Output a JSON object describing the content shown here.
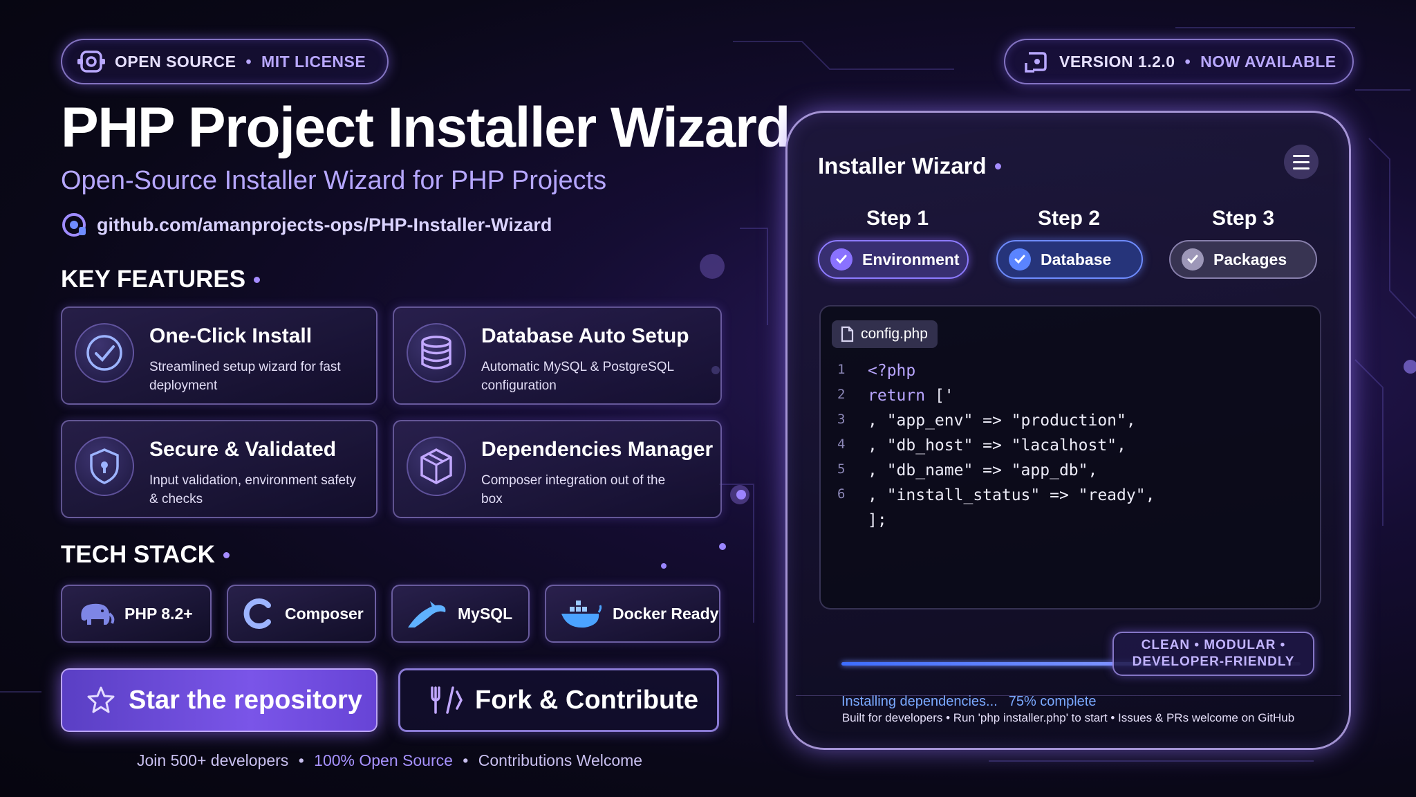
{
  "top_badges": {
    "left": {
      "text": "OPEN SOURCE",
      "sep": "•",
      "highlight": "MIT LICENSE",
      "icon": "code-repo-icon"
    },
    "right": {
      "text": "VERSION 1.2.0",
      "sep": "•",
      "highlight": "NOW AVAILABLE",
      "icon": "release-icon"
    }
  },
  "hero": {
    "title": "PHP Project Installer Wizard",
    "subtitle": "Open-Source Installer Wizard for PHP Projects",
    "repo_url": "github.com/amanprojects-ops/PHP-Installer-Wizard"
  },
  "features": {
    "heading": "KEY FEATURES",
    "items": [
      {
        "title": "One-Click Install",
        "desc": "Streamlined setup wizard for fast deployment",
        "icon": "check-circle-icon"
      },
      {
        "title": "Database Auto Setup",
        "desc": "Automatic MySQL & PostgreSQL configuration",
        "icon": "database-icon"
      },
      {
        "title": "Secure & Validated",
        "desc": "Input validation, environment safety & checks",
        "icon": "shield-icon"
      },
      {
        "title": "Dependencies Manager",
        "desc": "Composer integration out of the box",
        "icon": "package-icon"
      }
    ]
  },
  "tech": {
    "heading": "TECH STACK",
    "items": [
      {
        "label": "PHP 8.2+",
        "icon": "php-elephant-icon"
      },
      {
        "label": "Composer",
        "icon": "composer-icon"
      },
      {
        "label": "MySQL",
        "icon": "mysql-dolphin-icon"
      },
      {
        "label": "Docker Ready",
        "icon": "docker-whale-icon"
      }
    ]
  },
  "actions": {
    "star": {
      "label": "Star the repository",
      "icon": "star-icon"
    },
    "fork": {
      "label": "Fork & Contribute",
      "icon": "fork-icon"
    }
  },
  "footer_left": {
    "part1": "Join 500+ developers",
    "sep": "•",
    "part2": "100% Open Source",
    "part3": "Contributions Welcome"
  },
  "wizard": {
    "title": "Installer Wizard",
    "steps": [
      {
        "label": "Step 1",
        "name": "Environment",
        "state": "done"
      },
      {
        "label": "Step 2",
        "name": "Database",
        "state": "active"
      },
      {
        "label": "Step 3",
        "name": "Packages",
        "state": "pending"
      }
    ],
    "file_name": "config.php",
    "code_lines": [
      {
        "n": "1",
        "kw": "<?php",
        "rest": "",
        "green": false
      },
      {
        "n": "2",
        "kw": "return",
        "rest": " ['",
        "green": false
      },
      {
        "n": "3",
        "kw": "",
        "rest": ", \"app_env\" => \"production\",",
        "green": false
      },
      {
        "n": "4",
        "kw": "",
        "rest": ", \"db_host\" => \"lacalhost\",",
        "green": false
      },
      {
        "n": "5",
        "kw": "",
        "rest": ", \"db_name\" => \"app_db\",",
        "green": false
      },
      {
        "n": "6",
        "kw": "",
        "rest": ", \"install_status\" => \"ready\",",
        "green": true
      },
      {
        "n": "",
        "kw": "",
        "rest": "];",
        "green": false
      }
    ],
    "progress": {
      "text": "Installing dependencies...",
      "percent_text": "75% complete",
      "value": 0.72
    },
    "tag_line1": "CLEAN • MODULAR •",
    "tag_line2": "DEVELOPER-FRIENDLY",
    "footer": "Built for developers  •  Run 'php installer.php' to start  •  Issues & PRs welcome on GitHub"
  },
  "colors": {
    "accent": "#a58cff",
    "progress": "#4d7bff",
    "green_code": "#9ce86e"
  }
}
